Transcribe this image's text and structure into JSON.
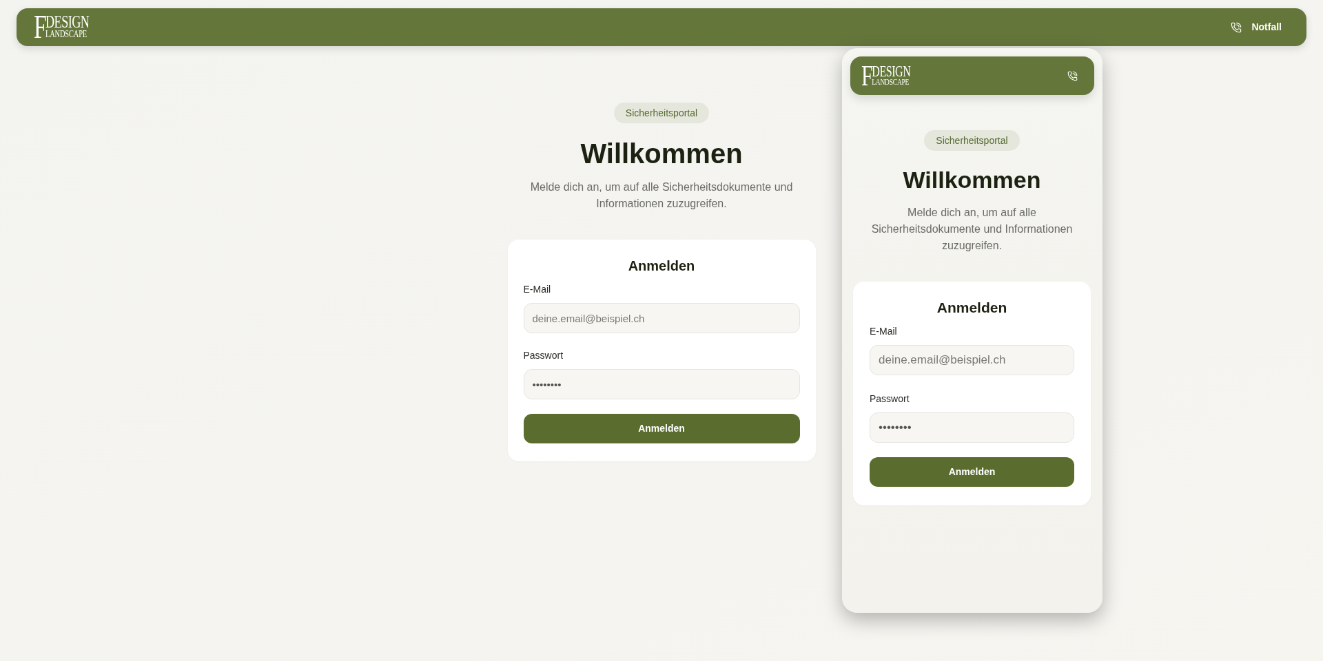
{
  "top_bar": {
    "logo": {
      "initial": "F",
      "line1": "DESIGN",
      "line2": "LANDSCAPE"
    },
    "emergency_link": {
      "label": "Notfall"
    }
  },
  "page": {
    "badge": "Sicherheitsportal",
    "title": "Willkommen",
    "description": "Melde dich an, um auf alle Sicherheitsdokumente und Informationen zuzugreifen.",
    "login_card": {
      "title": "Anmelden",
      "fields": [
        {
          "label": "E-Mail",
          "placeholder": "deine.email@beispiel.ch"
        },
        {
          "label": "Passwort",
          "value": "••••••••"
        }
      ],
      "submit_button": "Anmelden"
    }
  },
  "mobile_preview": {
    "header": {
      "logo": {
        "initial": "F",
        "line1": "DESIGN",
        "line2": "LANDSCAPE"
      }
    },
    "badge": "Sicherheitsportal",
    "title": "Willkommen",
    "description": "Melde dich an, um auf alle Sicherheitsdokumente und Informationen zuzugreifen.",
    "login_card": {
      "title": "Anmelden",
      "fields": [
        {
          "label": "E-Mail",
          "placeholder": "deine.email@beispiel.ch"
        },
        {
          "label": "Passwort",
          "value": "••••••••"
        }
      ],
      "submit_button": "Anmelden"
    }
  }
}
